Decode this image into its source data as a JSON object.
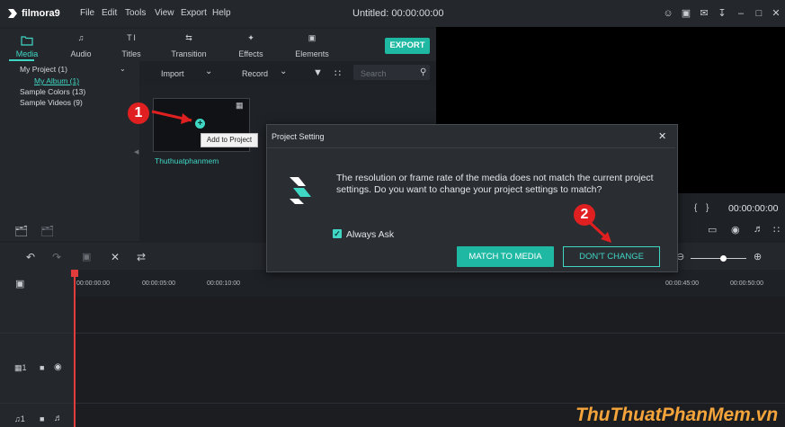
{
  "app": {
    "logo_text": "filmora9",
    "title": "Untitled: 00:00:00:00"
  },
  "menu": [
    "File",
    "Edit",
    "Tools",
    "View",
    "Export",
    "Help"
  ],
  "tabs": [
    {
      "label": "Media",
      "icon": "folder-icon",
      "active": true
    },
    {
      "label": "Audio",
      "icon": "music-note-icon"
    },
    {
      "label": "Titles",
      "icon": "text-icon"
    },
    {
      "label": "Transition",
      "icon": "transition-icon"
    },
    {
      "label": "Effects",
      "icon": "effects-icon"
    },
    {
      "label": "Elements",
      "icon": "image-icon"
    }
  ],
  "export_label": "EXPORT",
  "sidebar": {
    "items": [
      "My Project (1)",
      "My Album (1)",
      "Sample Colors (13)",
      "Sample Videos (9)"
    ]
  },
  "media_toolbar": {
    "import": "Import",
    "record": "Record",
    "search_placeholder": "Search"
  },
  "media": {
    "clip_name": "Thuthuatphanmem",
    "tooltip": "Add to Project"
  },
  "preview": {
    "timecode": "00:00:00:00"
  },
  "timeline": {
    "ruler": [
      "00:00:00:00",
      "00:00:05:00",
      "00:00:10:00",
      "00:00:45:00",
      "00:00:50:00"
    ]
  },
  "dialog": {
    "title": "Project Setting",
    "message": "The resolution or frame rate of the media does not match the current project settings. Do you want to change your project settings to match?",
    "checkbox_label": "Always Ask",
    "checkbox_checked": true,
    "match_button": "MATCH TO MEDIA",
    "dont_change_button": "DON'T CHANGE"
  },
  "annotations": {
    "step1": "1",
    "step2": "2"
  },
  "watermark": "ThuThuatPhanMem.vn",
  "colors": {
    "accent": "#1fb8a3",
    "highlight": "#3fd7c4",
    "annotation": "#e02020",
    "playhead": "#e23b3b"
  }
}
